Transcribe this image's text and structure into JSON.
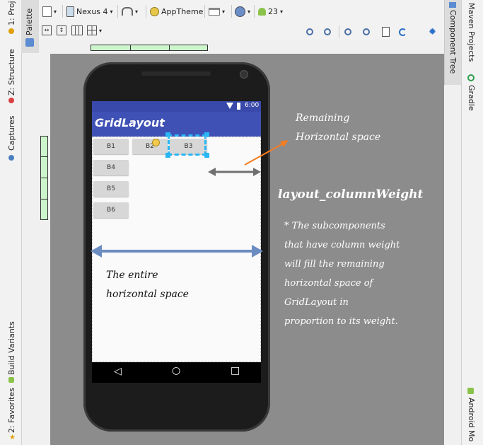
{
  "left_sidebar": {
    "project_tab": "1: Proj",
    "palette_tab": "Palette",
    "structure_tab": "Z: Structure",
    "captures_tab": "Captures",
    "build_variants_tab": "Build Variants",
    "favorites_tab": "2: Favorites"
  },
  "right_sidebar": {
    "maven_tab": "Maven Projects",
    "component_tree_tab": "Component Tree",
    "gradle_tab": "Gradle",
    "android_tab": "Android Mo"
  },
  "toolbar": {
    "device_label": "Nexus 4",
    "theme_label": "AppTheme",
    "api_label": "23"
  },
  "device": {
    "time": "6:00",
    "app_title": "GridLayout",
    "buttons": [
      "B1",
      "B2",
      "B3",
      "B4",
      "B5",
      "B6"
    ],
    "nav_back": "◁",
    "nav_home": "○",
    "nav_recent": "□"
  },
  "annotations": {
    "remaining_line1": "Remaining",
    "remaining_line2": "Horizontal space",
    "property_name": "layout_columnWeight",
    "desc_lines": [
      "* The subcomponents",
      "that have column weight",
      "will fill the remaining",
      "horizontal space of",
      "GridLayout in",
      "proportion to its weight."
    ],
    "entire_line1": "The entire",
    "entire_line2": "horizontal space"
  },
  "colors": {
    "app_bar": "#3f51b5",
    "status_bar": "#3949ab",
    "canvas": "#8c8c8c",
    "selection": "#29b6f6",
    "arrow_orange": "#f57c20",
    "arrow_blue": "#6b8cc0",
    "arrow_gray": "#707070"
  }
}
